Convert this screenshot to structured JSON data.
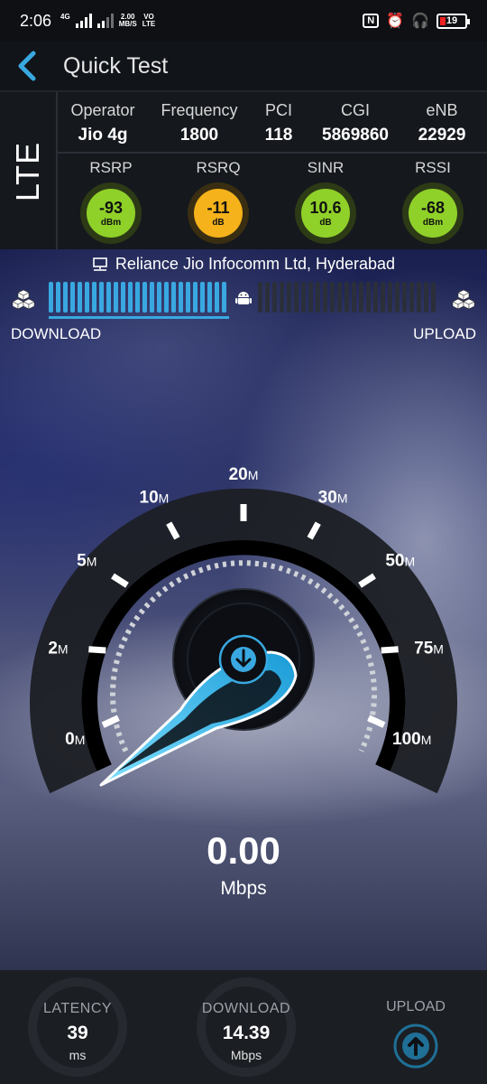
{
  "status_bar": {
    "time": "2:06",
    "net_type": "4G",
    "speed_value": "2.00",
    "speed_unit": "MB/S",
    "volte_top": "VO",
    "volte_bottom": "LTE",
    "battery": "19"
  },
  "app_bar": {
    "title": "Quick Test"
  },
  "network": {
    "tech": "LTE",
    "operator_label": "Operator",
    "operator": "Jio 4g",
    "frequency_label": "Frequency",
    "frequency": "1800",
    "pci_label": "PCI",
    "pci": "118",
    "cgi_label": "CGI",
    "cgi": "5869860",
    "enb_label": "eNB",
    "enb": "22929"
  },
  "metrics": [
    {
      "label": "RSRP",
      "value": "-93",
      "unit": "dBm",
      "color": "#8fd129"
    },
    {
      "label": "RSRQ",
      "value": "-11",
      "unit": "dB",
      "color": "#f5b21a"
    },
    {
      "label": "SINR",
      "value": "10.6",
      "unit": "dB",
      "color": "#8fd129"
    },
    {
      "label": "RSSI",
      "value": "-68",
      "unit": "dBm",
      "color": "#8fd129"
    }
  ],
  "server": "Reliance Jio Infocomm Ltd, Hyderabad",
  "progress": {
    "download_fraction": 1.0,
    "upload_fraction": 0.0
  },
  "labels": {
    "download": "DOWNLOAD",
    "upload": "UPLOAD"
  },
  "gauge": {
    "ticks": [
      {
        "num": "0",
        "unit": "M"
      },
      {
        "num": "2",
        "unit": "M"
      },
      {
        "num": "5",
        "unit": "M"
      },
      {
        "num": "10",
        "unit": "M"
      },
      {
        "num": "20",
        "unit": "M"
      },
      {
        "num": "30",
        "unit": "M"
      },
      {
        "num": "50",
        "unit": "M"
      },
      {
        "num": "75",
        "unit": "M"
      },
      {
        "num": "100",
        "unit": "M"
      }
    ],
    "current_speed": "0.00",
    "unit": "Mbps"
  },
  "results": {
    "latency_label": "LATENCY",
    "latency_value": "39",
    "latency_unit": "ms",
    "download_label": "DOWNLOAD",
    "download_value": "14.39",
    "download_unit": "Mbps",
    "upload_label": "UPLOAD"
  },
  "colors": {
    "accent": "#39a8e0",
    "bar_inactive": "#2b2f3a"
  }
}
